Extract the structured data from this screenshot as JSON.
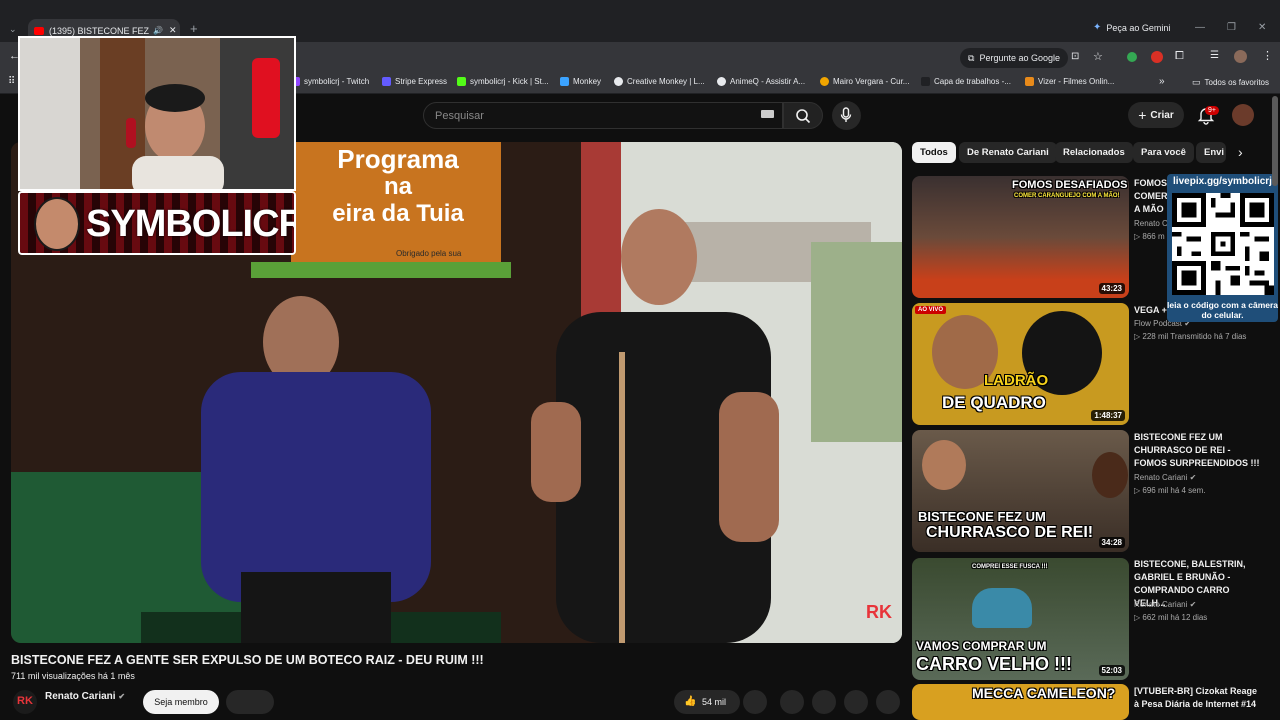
{
  "browser": {
    "tab_title": "(1395) BISTECONE FEZ A G",
    "gemini_label": "Peça ao Gemini",
    "google_button": "Pergunte ao Google",
    "bookmarks": [
      {
        "label": "symbolicrj - Twitch",
        "color": "#9146ff"
      },
      {
        "label": "Stripe Express",
        "color": "#635bff"
      },
      {
        "label": "symbolicrj - Kick | St...",
        "color": "#53fc18"
      },
      {
        "label": "Monkey",
        "color": "#3ba3ff"
      },
      {
        "label": "Creative Monkey | L...",
        "color": "#e8eaed"
      },
      {
        "label": "AnimeQ - Assistir A...",
        "color": "#e8eaed"
      },
      {
        "label": "Mairo Vergara - Cur...",
        "color": "#f0a500"
      },
      {
        "label": "Capa de trabalhos -...",
        "color": "#202124"
      },
      {
        "label": "Vizer - Filmes Onlin...",
        "color": "#e88a1a"
      }
    ],
    "favorites_label": "Todos os favoritos"
  },
  "youtube": {
    "search_placeholder": "Pesquisar",
    "create_label": "Criar",
    "notif_count": "9+"
  },
  "stream_overlay": {
    "name": "SYMBOLICRJ",
    "qr_header": "livepix.gg/symbolicrj",
    "qr_footer": "leia o código com a câmera do celular."
  },
  "video": {
    "sign_line1": "Programa",
    "sign_line2": "na",
    "sign_line3": "eira da Tuia",
    "sign_small": "Obrigado pela sua",
    "title": "BISTECONE FEZ A GENTE SER EXPULSO DE UM BOTECO RAIZ - DEU RUIM !!!",
    "meta": "711 mil visualizações  há 1 mês",
    "channel": "Renato Cariani",
    "join_label": "Seja membro",
    "likes": "54 mil"
  },
  "chips": [
    "Todos",
    "De Renato Cariani",
    "Relacionados",
    "Para você",
    "Envi"
  ],
  "related": [
    {
      "title": "FOMOS DESAFIADOS A COMER CARANGUEJO COM A MÃO",
      "title_visible": "FOMOS\nCOMER\nA MÃO",
      "channel": "Renato C",
      "meta": "866 m",
      "duration": "43:23",
      "thumb_text": "FOMOS DESAFIADOS",
      "thumb_sub": "COMER CARANGUEJO COM A MÃO!"
    },
    {
      "title": "VEGA +",
      "channel": "Flow Podcast",
      "meta": "228 mil   Transmitido há 7 dias",
      "duration": "1:48:37",
      "live": "AO VIVO",
      "thumb_text": "LADRÃO",
      "thumb_sub": "DE QUADRO"
    },
    {
      "title": "BISTECONE FEZ UM CHURRASCO DE REI - FOMOS SURPREENDIDOS !!!",
      "channel": "Renato Cariani",
      "meta": "696 mil   há 4 sem.",
      "duration": "34:28",
      "thumb_text": "BISTECONE FEZ UM",
      "thumb_sub": "CHURRASCO DE REI!"
    },
    {
      "title": "BISTECONE, BALESTRIN, GABRIEL E BRUNÃO - COMPRANDO CARRO VELH...",
      "channel": "Renato Cariani",
      "meta": "662 mil   há 12 dias",
      "duration": "52:03",
      "thumb_text": "VAMOS COMPRAR UM",
      "thumb_sub": "CARRO VELHO !!!",
      "thumb_tag": "COMPREI ESSE FUSCA !!!"
    },
    {
      "title": "[VTUBER-BR] Cizokat Reage à Pesa Diária de Internet #14",
      "thumb_text": "MECCA CAMELEON?"
    }
  ]
}
